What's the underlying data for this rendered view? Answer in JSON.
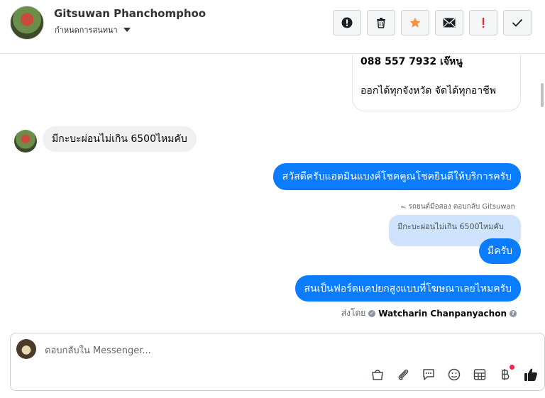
{
  "header": {
    "contact_name": "Gitsuwan Phanchomphoo",
    "subtitle": "กำหนดการสนทนา",
    "actions": [
      {
        "name": "alert-action-button",
        "icon": "exclamation-circle-icon"
      },
      {
        "name": "delete-action-button",
        "icon": "trash-icon"
      },
      {
        "name": "star-action-button",
        "icon": "star-icon"
      },
      {
        "name": "mark-unread-action-button",
        "icon": "envelope-icon"
      },
      {
        "name": "spam-action-button",
        "icon": "exclamation-icon"
      },
      {
        "name": "done-action-button",
        "icon": "check-icon"
      }
    ],
    "star_color": "#f7923b",
    "spam_color": "#e02424"
  },
  "messages": {
    "card_line1": "088 557 7932 เจ๊หนู",
    "card_line2": "ออกได้ทุกจังหวัด จัดได้ทุกอาชีพ",
    "customer_msg": "มีกะบะผ่อนไม่เกิน 6500ไหมคับ",
    "page_greeting": "สวัสดีครับแอดมินแบงค์โชคคูณโชคยินดีให้บริการครับ",
    "reply_label": "รถยนต์มือสอง ตอบกลับ Gitsuwan",
    "quoted_text": "มีกะบะผ่อนไม่เกิน 6500ไหมคับ",
    "page_reply": "มีครับ",
    "page_question": "สนเป็นฟอร์ดแคปยกสูงแบบที่โฆษณาเลยไหมครับ",
    "sent_by_prefix": "ส่งโดย",
    "sent_by_agent": "Watcharin Chanpanyachon"
  },
  "composer": {
    "placeholder": "ตอบกลับใน Messenger...",
    "tools": [
      "shopping-bag-icon",
      "paperclip-icon",
      "saved-reply-icon",
      "emoji-icon",
      "table-icon",
      "baht-icon",
      "thumbs-up-icon"
    ]
  },
  "colors": {
    "outgoing_bubble": "#0a7cff",
    "incoming_bubble": "#f0f0f0",
    "quoted_bubble": "#cfe3fd"
  }
}
